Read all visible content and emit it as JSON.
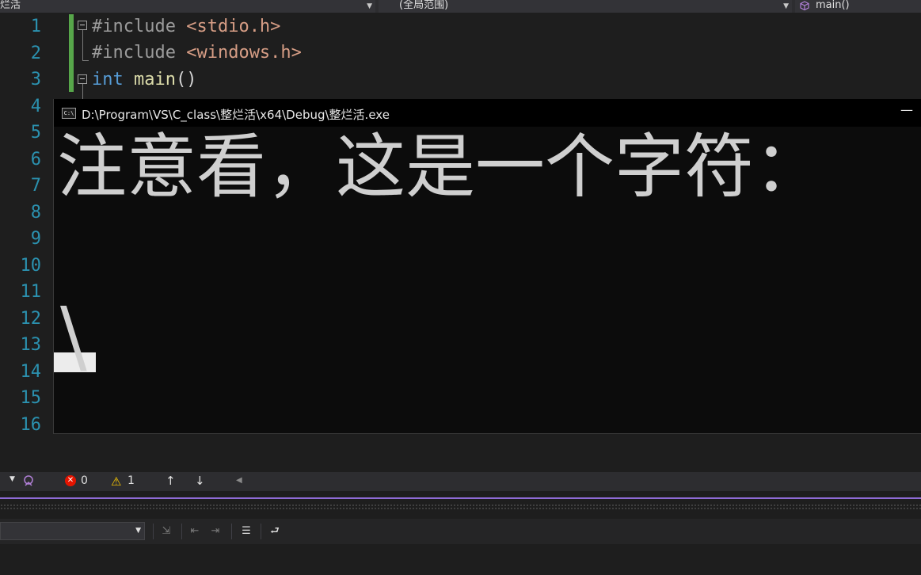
{
  "navbar": {
    "project": "烂活",
    "scope": "(全局范围)",
    "member": "main()"
  },
  "editor": {
    "line_numbers": [
      "1",
      "2",
      "3",
      "4",
      "5",
      "6",
      "7",
      "8",
      "9",
      "10",
      "11",
      "12",
      "13",
      "14",
      "15",
      "16"
    ],
    "code": {
      "l1_pp": "#include",
      "l1_hdr": "<stdio.h>",
      "l2_pp": "#include",
      "l2_hdr": "<windows.h>",
      "l3_kw": "int",
      "l3_fn": "main",
      "l3_paren": "()"
    }
  },
  "console": {
    "title": "D:\\Program\\VS\\C_class\\整烂活\\x64\\Debug\\整烂活.exe",
    "icon_text": "C:\\",
    "minimize": "—",
    "output_line": "注意看，这是一个字符：",
    "output_char": "\\"
  },
  "status": {
    "errors": "0",
    "warnings": "1"
  },
  "colors": {
    "accent_purple": "#8f6bd6",
    "change_green": "#57a64a",
    "line_number": "#2b91af",
    "keyword": "#569cd6",
    "string": "#d69d85"
  }
}
